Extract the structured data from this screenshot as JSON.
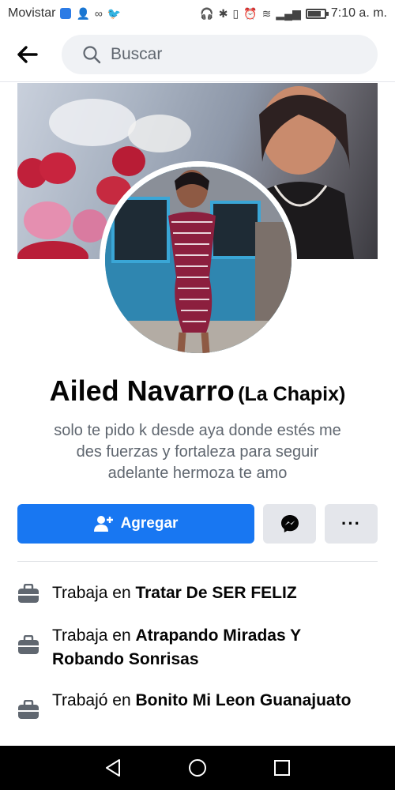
{
  "status_bar": {
    "carrier": "Movistar",
    "time": "7:10 a. m.",
    "battery_level": 0.8
  },
  "search": {
    "placeholder": "Buscar"
  },
  "profile": {
    "name": "Ailed Navarro",
    "alternate_name": "(La Chapix)",
    "bio": "solo te pido k desde aya donde estés me\ndes fuerzas y fortaleza para seguir\nadelante hermoza  te amo"
  },
  "actions": {
    "add_label": "Agregar",
    "more_label": "···"
  },
  "work": [
    {
      "prefix": "Trabaja en ",
      "place": "Tratar De SER FELIZ"
    },
    {
      "prefix": "Trabaja en ",
      "place": "Atrapando Miradas Y Robando Sonrisas"
    },
    {
      "prefix": "Trabajó en ",
      "place": "Bonito Mi Leon Guanajuato"
    }
  ],
  "icons": {
    "back": "arrow-left-icon",
    "search": "magnifier-icon",
    "add": "person-add-icon",
    "messenger": "messenger-icon",
    "work": "briefcase-icon"
  },
  "colors": {
    "accent": "#1877f2",
    "secondary_button": "#e4e6eb",
    "muted_text": "#606770"
  }
}
